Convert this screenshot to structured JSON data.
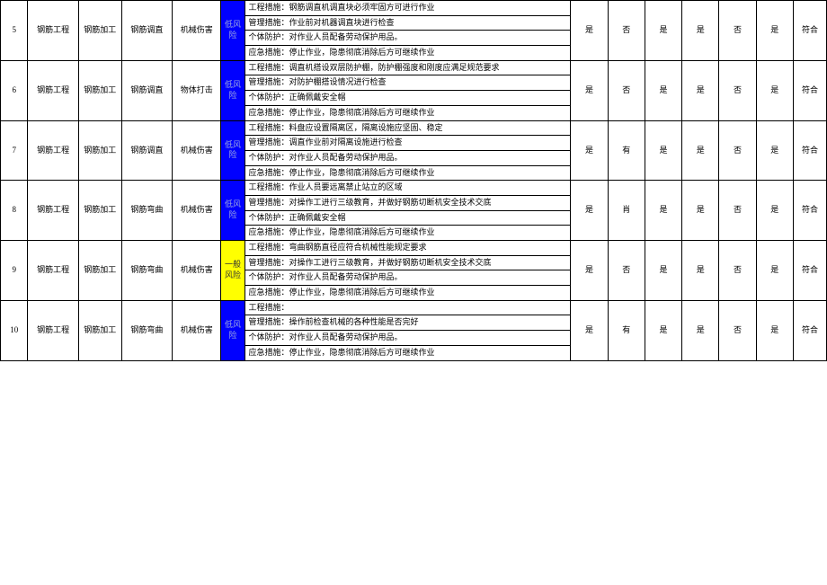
{
  "risk_labels": {
    "low": "低风险",
    "general": "一般风险"
  },
  "measure_prefixes": {
    "eng": "工程措施：",
    "mgmt": "管理措施：",
    "ppe": "个体防护：",
    "emg": "应急措施："
  },
  "rows": [
    {
      "idx": "5",
      "work": "钢筋工程",
      "sub": "钢筋加工",
      "op": "钢筋调直",
      "hazard": "机械伤害",
      "risk": "low",
      "measures": {
        "eng": "钢筋调直机调直块必须牢固方可进行作业",
        "mgmt": "作业前对机器调直块进行检查",
        "ppe": "对作业人员配备劳动保护用品。",
        "emg": "停止作业，隐患彻底消除后方可继续作业"
      },
      "cols": [
        "是",
        "否",
        "是",
        "是",
        "否",
        "是"
      ],
      "result": "符合"
    },
    {
      "idx": "6",
      "work": "钢筋工程",
      "sub": "钢筋加工",
      "op": "钢筋调直",
      "hazard": "物体打击",
      "risk": "low",
      "measures": {
        "eng": "调直机搭设双层防护棚，防护棚强度和刚度应满足规范要求",
        "mgmt": "对防护棚搭设情况进行检查",
        "ppe": "正确佩戴安全帽",
        "emg": "停止作业，隐患彻底消除后方可继续作业"
      },
      "cols": [
        "是",
        "否",
        "是",
        "是",
        "否",
        "是"
      ],
      "result": "符合"
    },
    {
      "idx": "7",
      "work": "钢筋工程",
      "sub": "钢筋加工",
      "op": "钢筋调直",
      "hazard": "机械伤害",
      "risk": "low",
      "measures": {
        "eng": "料盘应设置隔离区，隔离设施应坚固、稳定",
        "mgmt": "调直作业前对隔离设施进行检查",
        "ppe": "对作业人员配备劳动保护用品。",
        "emg": "停止作业，隐患彻底消除后方可继续作业"
      },
      "cols": [
        "是",
        "有",
        "是",
        "是",
        "否",
        "是"
      ],
      "result": "符合"
    },
    {
      "idx": "8",
      "work": "钢筋工程",
      "sub": "钢筋加工",
      "op": "钢筋弯曲",
      "hazard": "机械伤害",
      "risk": "low",
      "measures": {
        "eng": "作业人员要远离禁止站立的区域",
        "mgmt": "对操作工进行三级教育，并做好钢筋切断机安全技术交底",
        "ppe": "正确佩戴安全帽",
        "emg": "停止作业，隐患彻底消除后方可继续作业"
      },
      "cols": [
        "是",
        "肖",
        "是",
        "是",
        "否",
        "是"
      ],
      "result": "符合"
    },
    {
      "idx": "9",
      "work": "钢筋工程",
      "sub": "钢筋加工",
      "op": "钢筋弯曲",
      "hazard": "机械伤害",
      "risk": "general",
      "measures": {
        "eng": "弯曲钢筋直径应符合机械性能规定要求",
        "mgmt": "对操作工进行三级教育，并做好钢筋切断机安全技术交底",
        "ppe": "对作业人员配备劳动保护用品。",
        "emg": "停止作业，隐患彻底消除后方可继续作业"
      },
      "cols": [
        "是",
        "否",
        "是",
        "是",
        "否",
        "是"
      ],
      "result": "符合"
    },
    {
      "idx": "10",
      "work": "钢筋工程",
      "sub": "钢筋加工",
      "op": "钢筋弯曲",
      "hazard": "机械伤害",
      "risk": "low",
      "measures": {
        "eng": "",
        "mgmt": "操作前检查机械的各种性能是否完好",
        "ppe": "对作业人员配备劳动保护用品。",
        "emg": "停止作业，隐患彻底消除后方可继续作业"
      },
      "cols": [
        "是",
        "有",
        "是",
        "是",
        "否",
        "是"
      ],
      "result": "符合"
    }
  ]
}
